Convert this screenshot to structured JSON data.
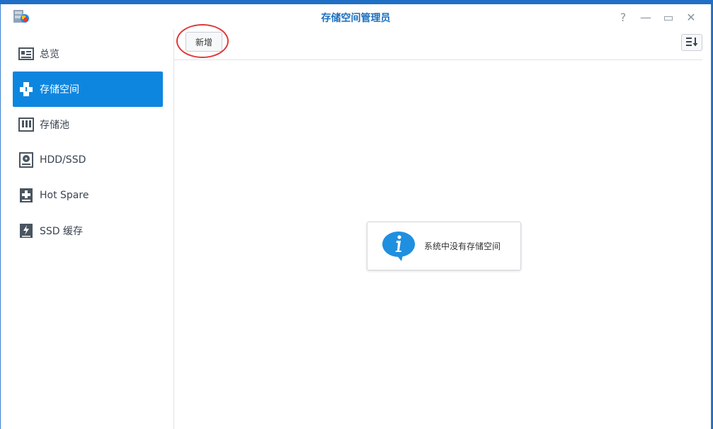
{
  "window": {
    "title": "存储空间管理员",
    "controls": [
      {
        "name": "help-icon",
        "glyph": "?"
      },
      {
        "name": "minimize-icon",
        "glyph": "—"
      },
      {
        "name": "maximize-icon",
        "glyph": "▭"
      },
      {
        "name": "close-icon",
        "glyph": "✕"
      }
    ]
  },
  "sidebar": {
    "items": [
      {
        "label": "总览",
        "icon": "overview-icon"
      },
      {
        "label": "存储空间",
        "icon": "volume-cubes-icon",
        "active": true
      },
      {
        "label": "存储池",
        "icon": "storage-pool-icon"
      },
      {
        "label": "HDD/SSD",
        "icon": "disk-icon"
      },
      {
        "label": "Hot Spare",
        "icon": "hot-spare-icon"
      },
      {
        "label": "SSD 缓存",
        "icon": "ssd-cache-icon"
      }
    ]
  },
  "toolbar": {
    "new_label": "新增",
    "sort_icon": "sort-icon"
  },
  "empty_state": {
    "message": "系统中没有存储空间",
    "icon": "info-bubble-icon"
  },
  "colors": {
    "accent": "#0d86e0",
    "title": "#1a6fbf",
    "highlight_circle": "#e0393a"
  }
}
